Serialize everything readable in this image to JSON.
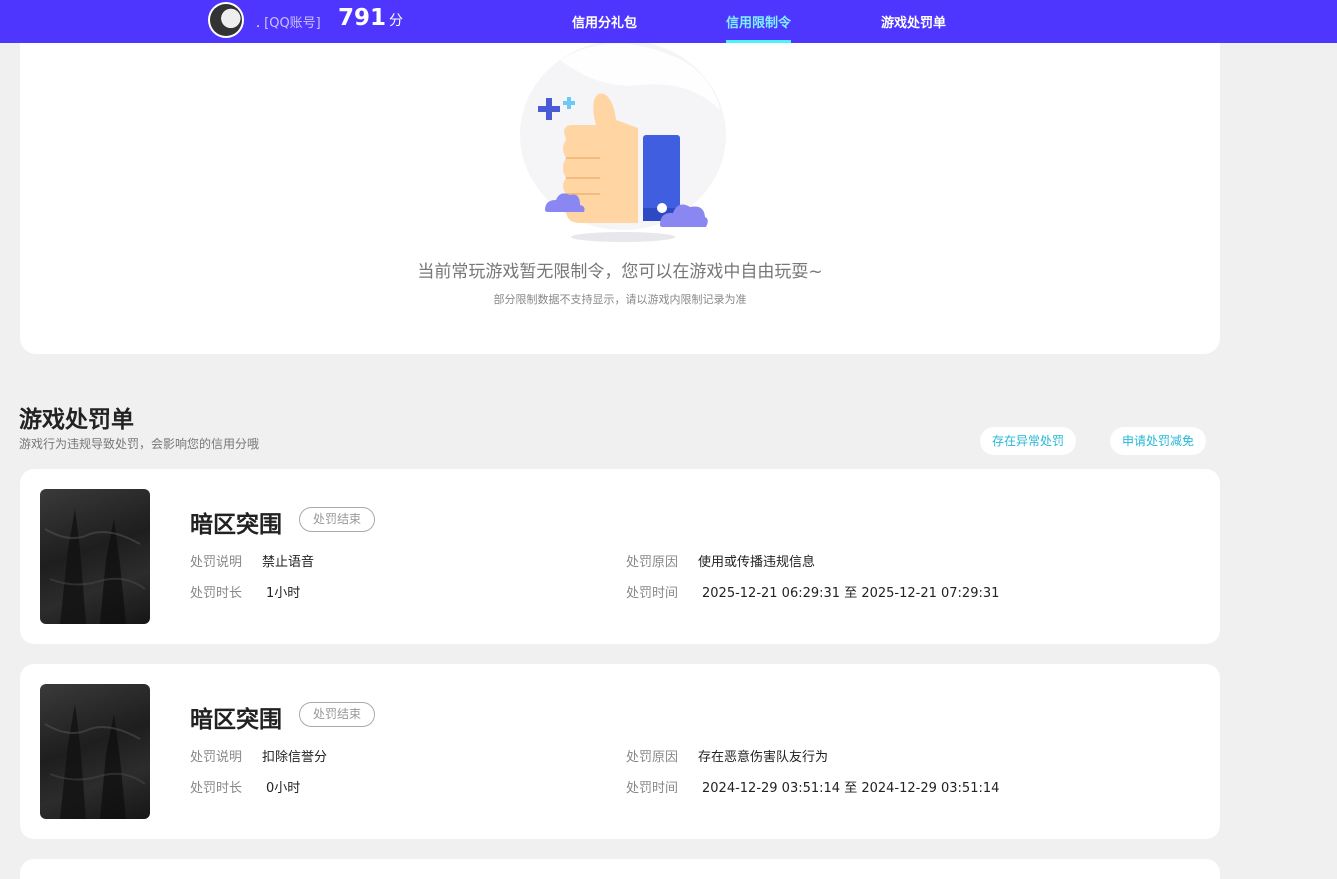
{
  "header": {
    "account_prefix": ".",
    "account_type": "[QQ账号]",
    "score": "791",
    "score_unit": "分",
    "nav": [
      {
        "label": "信用分礼包",
        "active": false
      },
      {
        "label": "信用限制令",
        "active": true
      },
      {
        "label": "游戏处罚单",
        "active": false
      }
    ],
    "colors": {
      "bar": "#4e36ff",
      "active": "#4ff0ff"
    }
  },
  "restriction": {
    "empty_message": "当前常玩游戏暂无限制令，您可以在游戏中自由玩耍~",
    "empty_note": "部分限制数据不支持显示，请以游戏内限制记录为准"
  },
  "penalties": {
    "title": "游戏处罚单",
    "subtitle": "游戏行为违规导致处罚，会影响您的信用分哦",
    "actions": [
      "存在异常处罚",
      "申请处罚减免"
    ],
    "labels": {
      "desc": "处罚说明",
      "duration": "处罚时长",
      "reason": "处罚原因",
      "time": "处罚时间"
    },
    "items": [
      {
        "game": "暗区突围",
        "status": "处罚结束",
        "desc": "禁止语音",
        "duration": "1小时",
        "reason": "使用或传播违规信息",
        "time": "2025-12-21 06:29:31 至 2025-12-21 07:29:31"
      },
      {
        "game": "暗区突围",
        "status": "处罚结束",
        "desc": "扣除信誉分",
        "duration": "0小时",
        "reason": "存在恶意伤害队友行为",
        "time": "2024-12-29 03:51:14 至 2024-12-29 03:51:14"
      }
    ]
  }
}
